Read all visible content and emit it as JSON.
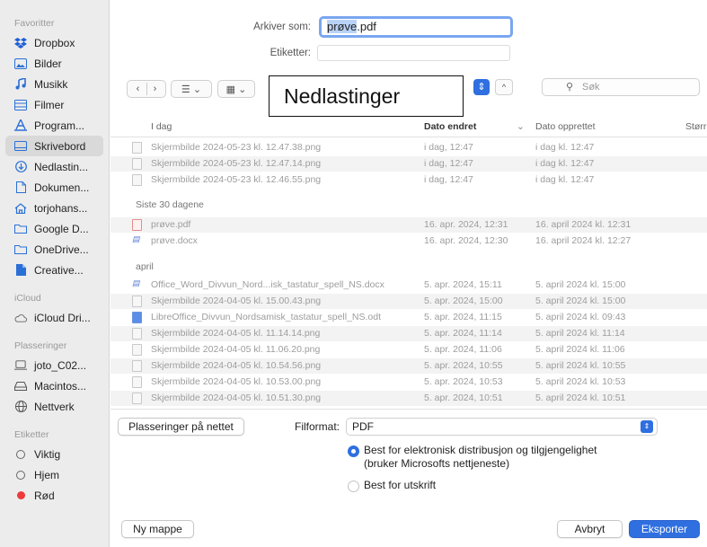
{
  "sidebar": {
    "favorites_label": "Favoritter",
    "favorites": [
      {
        "label": "Dropbox",
        "icon": "dropbox-icon"
      },
      {
        "label": "Bilder",
        "icon": "pictures-icon"
      },
      {
        "label": "Musikk",
        "icon": "music-icon"
      },
      {
        "label": "Filmer",
        "icon": "movies-icon"
      },
      {
        "label": "Program...",
        "icon": "applications-icon"
      },
      {
        "label": "Skrivebord",
        "icon": "desktop-icon",
        "selected": true
      },
      {
        "label": "Nedlastin...",
        "icon": "downloads-icon"
      },
      {
        "label": "Dokumen...",
        "icon": "documents-icon"
      },
      {
        "label": "torjohans...",
        "icon": "home-icon"
      },
      {
        "label": "Google D...",
        "icon": "folder-icon"
      },
      {
        "label": "OneDrive...",
        "icon": "folder-icon"
      },
      {
        "label": "Creative...",
        "icon": "file-icon"
      }
    ],
    "icloud_label": "iCloud",
    "icloud": [
      {
        "label": "iCloud Dri...",
        "icon": "cloud-icon"
      }
    ],
    "locations_label": "Plasseringer",
    "locations": [
      {
        "label": "joto_C02...",
        "icon": "computer-icon"
      },
      {
        "label": "Macintos...",
        "icon": "disk-icon"
      },
      {
        "label": "Nettverk",
        "icon": "network-icon"
      }
    ],
    "tags_label": "Etiketter",
    "tags": [
      {
        "label": "Viktig",
        "icon": "tag-empty-icon"
      },
      {
        "label": "Hjem",
        "icon": "tag-empty-icon"
      },
      {
        "label": "Rød",
        "icon": "tag-red-icon",
        "color": "#ee3a3a"
      }
    ]
  },
  "save": {
    "label": "Arkiver som:",
    "filename_selected": "prøve",
    "filename_ext": ".pdf",
    "tags_label": "Etiketter:",
    "tags_value": ""
  },
  "toolbar": {
    "back_icon": "chevron-left-icon",
    "forward_icon": "chevron-right-icon",
    "location_title": "Nedlastinger",
    "search_placeholder": "Søk"
  },
  "columns": {
    "name": "I dag",
    "modified": "Dato endret",
    "created": "Dato opprettet",
    "size": "Størr"
  },
  "groups": {
    "last30": "Siste 30 dagene",
    "april": "april"
  },
  "files_today": [
    {
      "name": "Skjermbilde 2024-05-23 kl. 12.47.38.png",
      "modified": "i dag, 12:47",
      "created": "i dag kl. 12:47",
      "type": "png"
    },
    {
      "name": "Skjermbilde 2024-05-23 kl. 12.47.14.png",
      "modified": "i dag, 12:47",
      "created": "i dag kl. 12:47",
      "type": "png"
    },
    {
      "name": "Skjermbilde 2024-05-23 kl. 12.46.55.png",
      "modified": "i dag, 12:47",
      "created": "i dag kl. 12:47",
      "type": "png"
    }
  ],
  "files_last30": [
    {
      "name": "prøve.pdf",
      "modified": "16. apr. 2024, 12:31",
      "created": "16. april 2024 kl. 12:31",
      "type": "pdf"
    },
    {
      "name": "prøve.docx",
      "modified": "16. apr. 2024, 12:30",
      "created": "16. april 2024 kl. 12:27",
      "type": "docx"
    }
  ],
  "files_april": [
    {
      "name": "Office_Word_Divvun_Nord...isk_tastatur_spell_NS.docx",
      "modified": "5. apr. 2024, 15:11",
      "created": "5. april 2024 kl. 15:00",
      "type": "docx"
    },
    {
      "name": "Skjermbilde 2024-04-05 kl. 15.00.43.png",
      "modified": "5. apr. 2024, 15:00",
      "created": "5. april 2024 kl. 15:00",
      "type": "png"
    },
    {
      "name": "LibreOffice_Divvun_Nordsamisk_tastatur_spell_NS.odt",
      "modified": "5. apr. 2024, 11:15",
      "created": "5. april 2024 kl. 09:43",
      "type": "odt"
    },
    {
      "name": "Skjermbilde 2024-04-05 kl. 11.14.14.png",
      "modified": "5. apr. 2024, 11:14",
      "created": "5. april 2024 kl. 11:14",
      "type": "png"
    },
    {
      "name": "Skjermbilde 2024-04-05 kl. 11.06.20.png",
      "modified": "5. apr. 2024, 11:06",
      "created": "5. april 2024 kl. 11:06",
      "type": "png"
    },
    {
      "name": "Skjermbilde 2024-04-05 kl. 10.54.56.png",
      "modified": "5. apr. 2024, 10:55",
      "created": "5. april 2024 kl. 10:55",
      "type": "png"
    },
    {
      "name": "Skjermbilde 2024-04-05 kl. 10.53.00.png",
      "modified": "5. apr. 2024, 10:53",
      "created": "5. april 2024 kl. 10:53",
      "type": "png"
    },
    {
      "name": "Skjermbilde 2024-04-05 kl. 10.51.30.png",
      "modified": "5. apr. 2024, 10:51",
      "created": "5. april 2024 kl. 10:51",
      "type": "png"
    }
  ],
  "bottom": {
    "online_locations": "Plasseringer på nettet",
    "format_label": "Filformat:",
    "format_value": "PDF",
    "option_electronic_line1": "Best for elektronisk distribusjon og tilgjengelighet",
    "option_electronic_line2": "(bruker Microsofts nettjeneste)",
    "option_print": "Best for utskrift",
    "new_folder": "Ny mappe",
    "cancel": "Avbryt",
    "export": "Eksporter"
  },
  "colors": {
    "accent": "#2f6fe0",
    "tag_red": "#ee3a3a"
  }
}
